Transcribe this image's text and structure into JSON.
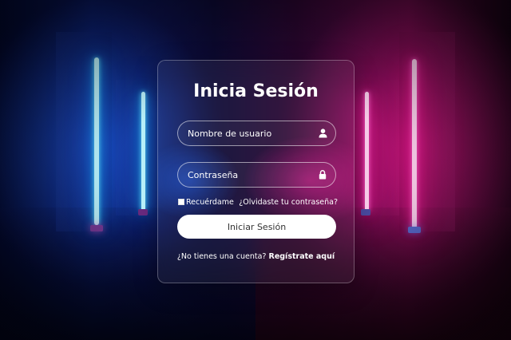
{
  "login": {
    "title": "Inicia Sesión",
    "username_placeholder": "Nombre de usuario",
    "password_placeholder": "Contraseña",
    "remember_label": "Recuérdame",
    "forgot_link": "¿Olvidaste tu contraseña?",
    "submit_label": "Iniciar Sesión",
    "signup_prompt": "¿No tienes una cuenta?",
    "signup_link": "Regístrate aquí"
  },
  "icons": {
    "username_icon": "user-icon",
    "password_icon": "lock-icon"
  },
  "colors": {
    "accent_blue": "#1fb6ff",
    "accent_pink": "#ff1493",
    "button_bg": "#ffffff",
    "text": "#ffffff"
  }
}
